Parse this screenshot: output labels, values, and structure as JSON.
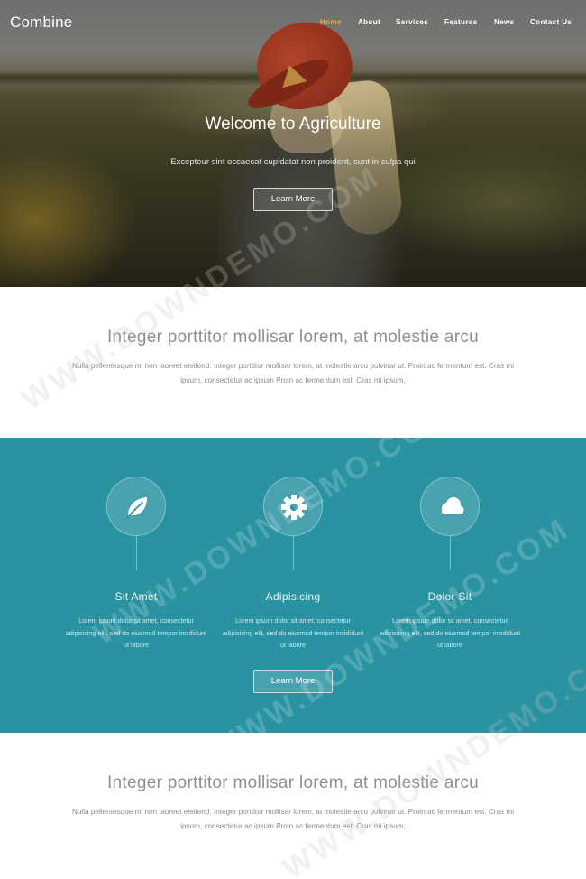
{
  "brand": "Combine",
  "nav": {
    "items": [
      {
        "label": "Home",
        "active": true
      },
      {
        "label": "About",
        "active": false
      },
      {
        "label": "Services",
        "active": false
      },
      {
        "label": "Features",
        "active": false
      },
      {
        "label": "News",
        "active": false
      },
      {
        "label": "Contact Us",
        "active": false
      }
    ]
  },
  "hero": {
    "title": "Welcome to Agriculture",
    "subtitle": "Excepteur sint occaecat cupidatat non proident, sunt in culpa qui",
    "button": "Learn More"
  },
  "intro": {
    "title": "Integer porttitor mollisar lorem, at molestie arcu",
    "text": "Nulla pellentesque mi non laoreet eleifend. Integer porttitor mollisar lorem, at molestie arcu pulvinar ut. Proin ac fermentum est. Cras mi ipsum, consectetur ac ipsum Proin ac fermentum est. Cras mi ipsum,"
  },
  "features": {
    "items": [
      {
        "icon": "leaf-icon",
        "title": "Sit Amet",
        "text": "Lorem ipsum dolor sit amet, consectetur adipisicing elit, sed do eiusmod tempor incididunt ut labore"
      },
      {
        "icon": "gear-icon",
        "title": "Adipisicing",
        "text": "Lorem ipsum dolor sit amet, consectetur adipisicing elit, sed do eiusmod tempor incididunt ut labore"
      },
      {
        "icon": "cloud-icon",
        "title": "Dolor Sit",
        "text": "Lorem ipsum dolor sit amet, consectetur adipisicing elit, sed do eiusmod tempor incididunt ut labore"
      }
    ],
    "button": "Learn More",
    "background": "#2a93a2"
  },
  "outro": {
    "title": "Integer porttitor mollisar lorem, at molestie arcu",
    "text": "Nulla pellentesque mi non laoreet eleifend. Integer porttitor mollisar lorem, at molestie arcu pulvinar ut. Proin ac fermentum est. Cras mi ipsum, consectetur ac ipsum Proin ac fermentum est. Cras mi ipsum,"
  },
  "watermark": "WWW.DOWNDEMO.COM",
  "colors": {
    "active_nav": "#f0b429",
    "teal": "#2a93a2"
  }
}
